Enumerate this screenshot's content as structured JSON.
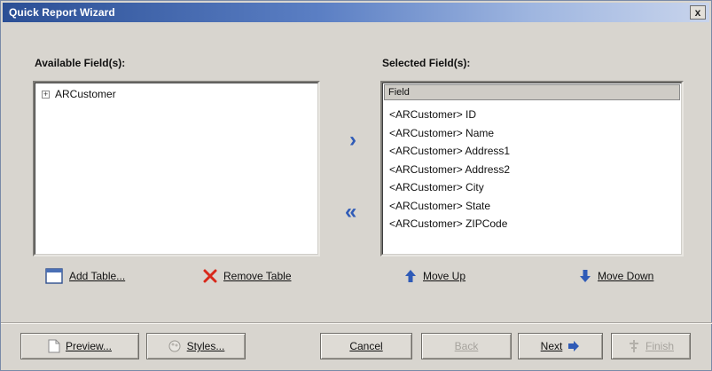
{
  "window": {
    "title": "Quick Report Wizard",
    "close_label": "x"
  },
  "available": {
    "heading": "Available Field(s):",
    "tree": [
      {
        "expander": "+",
        "label": "ARCustomer"
      }
    ]
  },
  "selected": {
    "heading": "Selected Field(s):",
    "column_header": "Field",
    "fields": [
      "<ARCustomer> ID",
      "<ARCustomer> Name",
      "<ARCustomer> Address1",
      "<ARCustomer> Address2",
      "<ARCustomer> City",
      "<ARCustomer> State",
      "<ARCustomer> ZIPCode"
    ]
  },
  "transfer": {
    "add_glyph": "›",
    "remove_all_glyph": "«"
  },
  "table_tools": {
    "add_label": "Add Table...",
    "remove_label": "Remove Table"
  },
  "order_tools": {
    "up_label": "Move Up",
    "down_label": "Move Down"
  },
  "buttons": {
    "preview": "Preview...",
    "styles": "Styles...",
    "cancel": "Cancel",
    "back": "Back",
    "next": "Next",
    "finish": "Finish"
  },
  "colors": {
    "accent_blue": "#2f5bb7",
    "remove_red": "#d8281a",
    "title_bar": "#2b4f95"
  }
}
